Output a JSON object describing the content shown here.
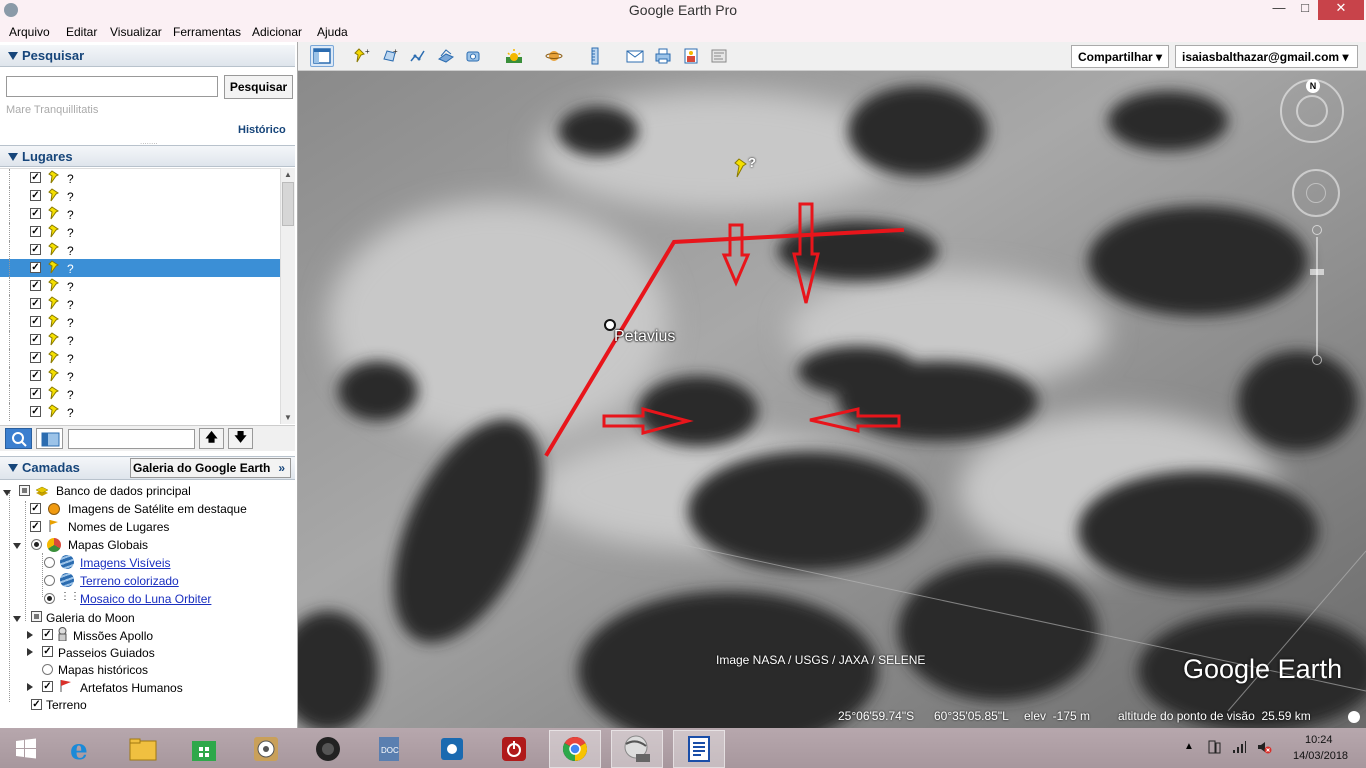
{
  "window": {
    "title": "Google Earth Pro"
  },
  "menu": [
    "Arquivo",
    "Editar",
    "Visualizar",
    "Ferramentas",
    "Adicionar",
    "Ajuda"
  ],
  "search": {
    "header": "Pesquisar",
    "input_value": "",
    "button": "Pesquisar",
    "hint": "Mare Tranquillitatis",
    "history_link": "Histórico"
  },
  "places": {
    "header": "Lugares",
    "items": [
      "?",
      "?",
      "?",
      "?",
      "?",
      "?",
      "?",
      "?",
      "?",
      "?",
      "?",
      "?",
      "?",
      "?"
    ],
    "selected_index": 5
  },
  "layers": {
    "header": "Camadas",
    "gallery_button": "Galeria do Google Earth",
    "items": [
      {
        "label": "Banco de dados principal"
      },
      {
        "label": "Imagens de Satélite em destaque"
      },
      {
        "label": "Nomes de Lugares"
      },
      {
        "label": "Mapas Globais"
      },
      {
        "label": "Imagens Visíveis"
      },
      {
        "label": "Terreno colorizado"
      },
      {
        "label": "Mosaico do Luna Orbiter"
      },
      {
        "label": "Galeria do Moon"
      },
      {
        "label": "Missões Apollo"
      },
      {
        "label": "Passeios Guiados"
      },
      {
        "label": "Mapas históricos"
      },
      {
        "label": "Artefatos Humanos"
      },
      {
        "label": "Terreno"
      }
    ]
  },
  "toolbar": {
    "share": "Compartilhar",
    "account": "isaiasbalthazar@gmail.com"
  },
  "map": {
    "place_label": "Petavius",
    "pin_label": "?",
    "attribution": "Image NASA / USGS / JAXA / SELENE",
    "brand": "Google Earth",
    "compass_north": "N",
    "status": {
      "lat": "25°06'59.74\"S",
      "lon": "60°35'05.85\"L",
      "elev": "elev  -175 m",
      "eye": "altitude do ponto de visão  25.59 km"
    }
  },
  "taskbar": {
    "time": "10:24",
    "date": "14/03/2018"
  }
}
